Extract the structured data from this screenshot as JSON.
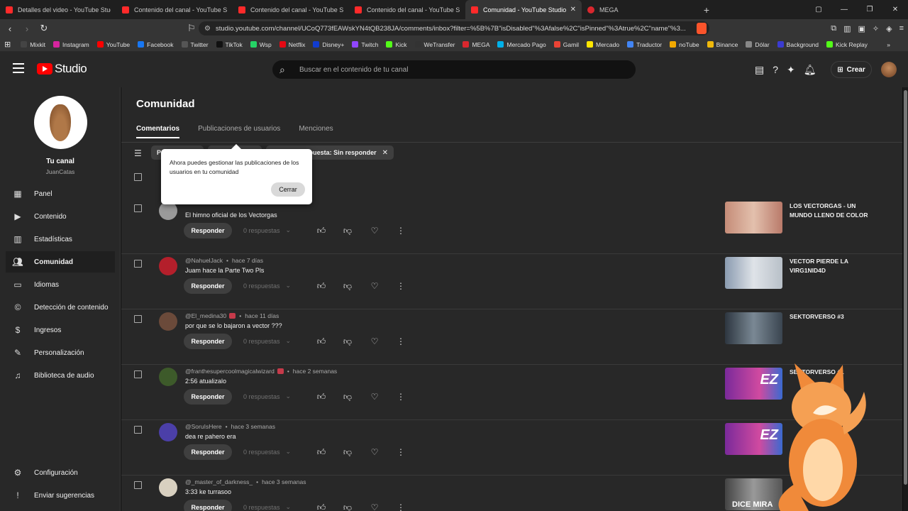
{
  "browser": {
    "tabs": [
      {
        "title": "Detalles del video - YouTube Studio",
        "icon": "youtube",
        "active": false
      },
      {
        "title": "Contenido del canal - YouTube Studio",
        "icon": "youtube",
        "active": false
      },
      {
        "title": "Contenido del canal - YouTube Studio",
        "icon": "youtube",
        "active": false
      },
      {
        "title": "Contenido del canal - YouTube Studio",
        "icon": "youtube",
        "active": false
      },
      {
        "title": "Comunidad - YouTube Studio",
        "icon": "youtube",
        "active": true
      },
      {
        "title": "MEGA",
        "icon": "mega",
        "active": false
      }
    ],
    "new_tab": "+",
    "url": "studio.youtube.com/channel/UCoQ773fEAWskYN4tQB238JA/comments/inbox?filter=%5B%7B\"isDisabled\"%3Afalse%2C\"isPinned\"%3Atrue%2C\"name\"%3...",
    "bookmarks": [
      {
        "label": "Mixkit",
        "color": "#444444"
      },
      {
        "label": "Instagram",
        "color": "#d6249f"
      },
      {
        "label": "YouTube",
        "color": "#ff0000"
      },
      {
        "label": "Facebook",
        "color": "#1877f2"
      },
      {
        "label": "Twitter",
        "color": "#555555"
      },
      {
        "label": "TikTok",
        "color": "#111111"
      },
      {
        "label": "Wsp",
        "color": "#25d366"
      },
      {
        "label": "Netflix",
        "color": "#e50914"
      },
      {
        "label": "Disney+",
        "color": "#113ccf"
      },
      {
        "label": "Twitch",
        "color": "#9146ff"
      },
      {
        "label": "Kick",
        "color": "#53fc18"
      },
      {
        "label": "WeTransfer",
        "color": "#333333"
      },
      {
        "label": "MEGA",
        "color": "#d9272e"
      },
      {
        "label": "Mercado Pago",
        "color": "#00b1ea"
      },
      {
        "label": "Gamil",
        "color": "#ea4335"
      },
      {
        "label": "Mercado",
        "color": "#ffe600"
      },
      {
        "label": "Traductor",
        "color": "#4285f4"
      },
      {
        "label": "noTube",
        "color": "#f2a900"
      },
      {
        "label": "Binance",
        "color": "#f0b90b"
      },
      {
        "label": "Dólar",
        "color": "#888888"
      },
      {
        "label": "Background",
        "color": "#3b3bd1"
      },
      {
        "label": "Kick Replay",
        "color": "#53fc18"
      }
    ]
  },
  "header": {
    "logo_text": "Studio",
    "search_placeholder": "Buscar en el contenido de tu canal",
    "create_label": "Crear"
  },
  "sidebar": {
    "channel_name": "Tu canal",
    "channel_handle": "JuanCatas",
    "items": [
      {
        "label": "Panel",
        "icon": "dashboard-icon",
        "active": false
      },
      {
        "label": "Contenido",
        "icon": "content-icon",
        "active": false
      },
      {
        "label": "Estadísticas",
        "icon": "analytics-icon",
        "active": false
      },
      {
        "label": "Comunidad",
        "icon": "community-icon",
        "active": true
      },
      {
        "label": "Idiomas",
        "icon": "subtitles-icon",
        "active": false
      },
      {
        "label": "Detección de contenido",
        "icon": "copyright-icon",
        "active": false
      },
      {
        "label": "Ingresos",
        "icon": "earn-icon",
        "active": false
      },
      {
        "label": "Personalización",
        "icon": "customization-icon",
        "active": false
      },
      {
        "label": "Biblioteca de audio",
        "icon": "audio-library-icon",
        "active": false
      }
    ],
    "bottom_items": [
      {
        "label": "Configuración",
        "icon": "settings-icon"
      },
      {
        "label": "Enviar sugerencias",
        "icon": "feedback-icon"
      }
    ]
  },
  "main": {
    "title": "Comunidad",
    "tabs": [
      {
        "label": "Comentarios",
        "active": true
      },
      {
        "label": "Publicaciones de usuarios",
        "active": false
      },
      {
        "label": "Menciones",
        "active": false
      }
    ],
    "filter_chips": [
      {
        "label": "P"
      },
      {
        "label": ""
      },
      {
        "label": "puesta: Sin responder"
      }
    ],
    "reply_label": "Responder",
    "comments": [
      {
        "author": "",
        "time": "",
        "text": "El himno oficial de los Vectorgas",
        "replies": "0 respuestas",
        "video_title": "LOS VECTORGAS - UN MUNDO LLENO DE COLOR",
        "badge": false,
        "avatar_color": "#9a9a9a",
        "thumb_color": "#b97a6a"
      },
      {
        "author": "@NahuelJack",
        "time": "hace 7 días",
        "text": "Juam hace la Parte Two Pls",
        "replies": "0 respuestas",
        "video_title": "VECTOR PIERDE LA VIRG1NID4D",
        "badge": false,
        "avatar_color": "#b41f2b",
        "thumb_color": "#c9cfd6"
      },
      {
        "author": "@El_medina30",
        "time": "hace 11 días",
        "text": "por que se lo bajaron a vector ???",
        "replies": "0 respuestas",
        "video_title": "SEKTORVERSO #3",
        "badge": true,
        "avatar_color": "#6b4a3a",
        "thumb_color": "#4a5560"
      },
      {
        "author": "@franthesupercoolmagicalwizard",
        "time": "hace 2 semanas",
        "text": "2:56 atualizalo",
        "replies": "0 respuestas",
        "video_title": "SEKTORVERSO #1",
        "badge": true,
        "avatar_color": "#3d5a2a",
        "thumb_color": "#a0307a"
      },
      {
        "author": "@SoruIsHere",
        "time": "hace 3 semanas",
        "text": "dea re pahero era",
        "replies": "0 respuestas",
        "video_title": "",
        "badge": false,
        "avatar_color": "#4b3fa8",
        "thumb_color": "#a0307a"
      },
      {
        "author": "@_master_of_darkness_",
        "time": "hace 3 semanas",
        "text": "3:33 ke turrasoo",
        "replies": "0 respuestas",
        "video_title": "",
        "badge": false,
        "avatar_color": "#d8d0c0",
        "thumb_color": "#555555"
      }
    ],
    "thumb_overlay_text": {
      "row4": "EZ",
      "row5": "EZ",
      "row6": "DICE MIRA"
    }
  },
  "popup": {
    "message": "Ahora puedes gestionar las publicaciones de los usuarios en tu comunidad",
    "close_label": "Cerrar"
  }
}
